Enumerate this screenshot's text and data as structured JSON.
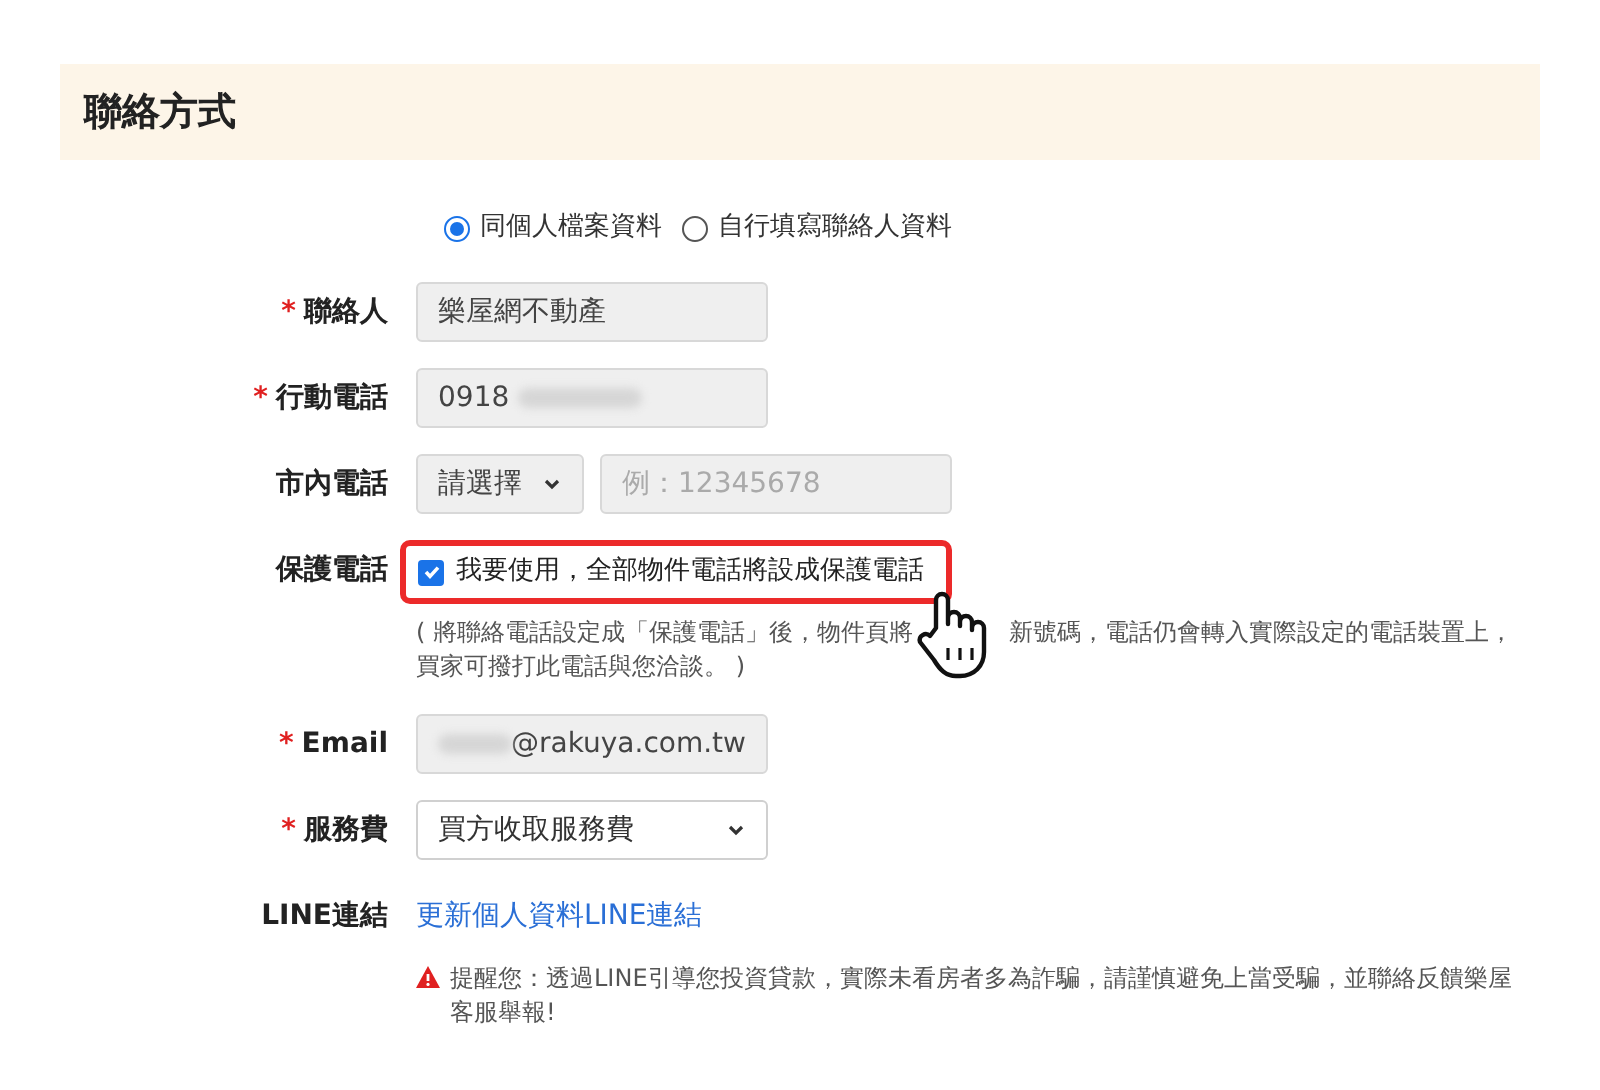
{
  "section": {
    "title": "聯絡方式"
  },
  "source_options": [
    {
      "label": "同個人檔案資料",
      "selected": true
    },
    {
      "label": "自行填寫聯絡人資料",
      "selected": false
    }
  ],
  "fields": [
    {
      "kind": "text",
      "required_mark": "*",
      "label": "聯絡人",
      "value": "樂屋網不動產"
    },
    {
      "kind": "masked",
      "required_mark": "*",
      "label": "行動電話",
      "value": "0918"
    },
    {
      "kind": "phone",
      "label": "市內電話",
      "select": "請選擇",
      "placeholder": "例：12345678"
    },
    {
      "kind": "checkbox",
      "label": "保護電話",
      "checked": true,
      "option": "我要使用，全部物件電話將設成保護電話",
      "hint": [
        "( 將聯絡電話設定成「保護電話」後，物件頁將",
        "新號碼，電話仍會轉入實際設定的電話裝置上，",
        "買家可撥打此電話與您洽談。 )"
      ]
    },
    {
      "kind": "email",
      "required_mark": "*",
      "label": "Email",
      "value": "@rakuya.com.tw"
    },
    {
      "kind": "select",
      "required_mark": "*",
      "label": "服務費",
      "value": "買方收取服務費"
    },
    {
      "kind": "link",
      "label": "LINE連結",
      "link": "更新個人資料LINE連結",
      "warning": "提醒您：透過LINE引導您投資貸款，實際未看房者多為詐騙，請謹慎避免上當受騙，並聯絡反饋樂屋客服舉報!"
    }
  ]
}
